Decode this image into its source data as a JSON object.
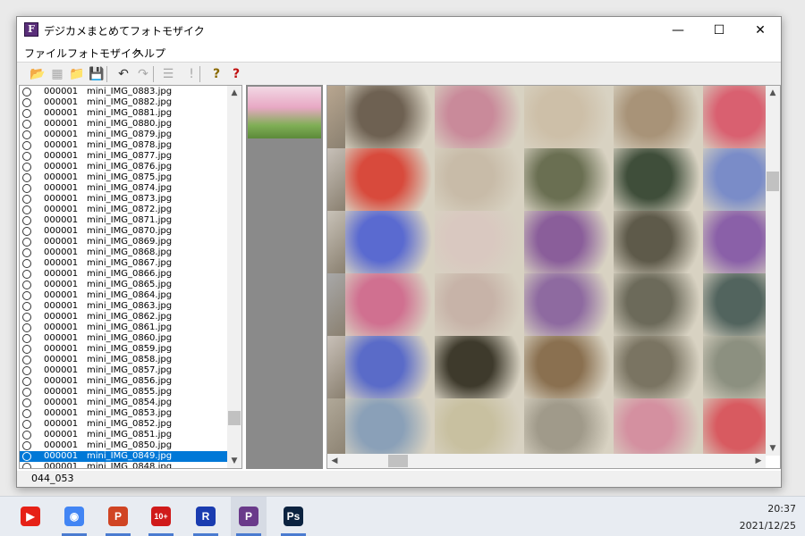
{
  "window": {
    "title": "デジカメまとめてフォトモザイク",
    "icon_letter": "F",
    "controls": {
      "minimize": "—",
      "maximize": "☐",
      "close": "✕"
    }
  },
  "menu": [
    "ファイル",
    "フォトモザイク",
    "ヘルプ"
  ],
  "toolbar": [
    {
      "name": "open-folder-icon",
      "glyph": "📂"
    },
    {
      "name": "new-image-icon",
      "glyph": "▦",
      "disabled": true
    },
    {
      "name": "folder-icon",
      "glyph": "📁"
    },
    {
      "name": "save-icon",
      "glyph": "💾"
    },
    {
      "name": "undo-icon",
      "glyph": "↶"
    },
    {
      "name": "redo-icon",
      "glyph": "↷",
      "disabled": true
    },
    {
      "name": "settings-list-icon",
      "glyph": "☰",
      "disabled": true
    },
    {
      "name": "exclamation-icon",
      "glyph": "!",
      "disabled": true
    },
    {
      "name": "help-icon",
      "glyph": "?"
    },
    {
      "name": "about-help-icon",
      "glyph": "?"
    }
  ],
  "file_list": {
    "selected_index": 34,
    "items": [
      {
        "count": "000001",
        "name": "mini_IMG_0883.jpg"
      },
      {
        "count": "000001",
        "name": "mini_IMG_0882.jpg"
      },
      {
        "count": "000001",
        "name": "mini_IMG_0881.jpg"
      },
      {
        "count": "000001",
        "name": "mini_IMG_0880.jpg"
      },
      {
        "count": "000001",
        "name": "mini_IMG_0879.jpg"
      },
      {
        "count": "000001",
        "name": "mini_IMG_0878.jpg"
      },
      {
        "count": "000001",
        "name": "mini_IMG_0877.jpg"
      },
      {
        "count": "000001",
        "name": "mini_IMG_0876.jpg"
      },
      {
        "count": "000001",
        "name": "mini_IMG_0875.jpg"
      },
      {
        "count": "000001",
        "name": "mini_IMG_0874.jpg"
      },
      {
        "count": "000001",
        "name": "mini_IMG_0873.jpg"
      },
      {
        "count": "000001",
        "name": "mini_IMG_0872.jpg"
      },
      {
        "count": "000001",
        "name": "mini_IMG_0871.jpg"
      },
      {
        "count": "000001",
        "name": "mini_IMG_0870.jpg"
      },
      {
        "count": "000001",
        "name": "mini_IMG_0869.jpg"
      },
      {
        "count": "000001",
        "name": "mini_IMG_0868.jpg"
      },
      {
        "count": "000001",
        "name": "mini_IMG_0867.jpg"
      },
      {
        "count": "000001",
        "name": "mini_IMG_0866.jpg"
      },
      {
        "count": "000001",
        "name": "mini_IMG_0865.jpg"
      },
      {
        "count": "000001",
        "name": "mini_IMG_0864.jpg"
      },
      {
        "count": "000001",
        "name": "mini_IMG_0863.jpg"
      },
      {
        "count": "000001",
        "name": "mini_IMG_0862.jpg"
      },
      {
        "count": "000001",
        "name": "mini_IMG_0861.jpg"
      },
      {
        "count": "000001",
        "name": "mini_IMG_0860.jpg"
      },
      {
        "count": "000001",
        "name": "mini_IMG_0859.jpg"
      },
      {
        "count": "000001",
        "name": "mini_IMG_0858.jpg"
      },
      {
        "count": "000001",
        "name": "mini_IMG_0857.jpg"
      },
      {
        "count": "000001",
        "name": "mini_IMG_0856.jpg"
      },
      {
        "count": "000001",
        "name": "mini_IMG_0855.jpg"
      },
      {
        "count": "000001",
        "name": "mini_IMG_0854.jpg"
      },
      {
        "count": "000001",
        "name": "mini_IMG_0853.jpg"
      },
      {
        "count": "000001",
        "name": "mini_IMG_0852.jpg"
      },
      {
        "count": "000001",
        "name": "mini_IMG_0851.jpg"
      },
      {
        "count": "000001",
        "name": "mini_IMG_0850.jpg"
      },
      {
        "count": "000001",
        "name": "mini_IMG_0849.jpg"
      },
      {
        "count": "000001",
        "name": "mini_IMG_0848.jpg"
      }
    ]
  },
  "scrollbars": {
    "up": "▲",
    "down": "▼",
    "left": "◀",
    "right": "▶"
  },
  "mosaic": {
    "tiles": [
      [
        "#6e6152",
        "#c98a9a",
        "#cdbfa8",
        "#a89378",
        "#d96070"
      ],
      [
        "#d84a3c",
        "#c8bba8",
        "#6a6f52",
        "#3f4e3a",
        "#7a8cc8"
      ],
      [
        "#5a6ad0",
        "#d9c8c0",
        "#8a5e9a",
        "#5e5a4a",
        "#8a60a8"
      ],
      [
        "#d07090",
        "#c7b3a8",
        "#8e6aa0",
        "#6c6a5a",
        "#52645e"
      ],
      [
        "#5a6bc8",
        "#3e3a2c",
        "#8a7050",
        "#7a7462",
        "#8c9080"
      ],
      [
        "#8aa0b8",
        "#c8c0a0",
        "#a09a8a",
        "#d490a0",
        "#d85a60"
      ]
    ],
    "left_strip": [
      "#b8a690",
      "#c7c0b8",
      "#c8c2b8",
      "#a8a8a8",
      "#c8c0b8",
      "#b0a898"
    ]
  },
  "status": {
    "text": "044_053"
  },
  "taskbar": {
    "apps": [
      {
        "name": "youtube-icon",
        "glyph": "▶",
        "color": "#e62117"
      },
      {
        "name": "chrome-icon",
        "glyph": "◉",
        "color": "#4285f4"
      },
      {
        "name": "powerpoint-icon",
        "glyph": "P",
        "color": "#d04423"
      },
      {
        "name": "ten-plus-icon",
        "glyph": "10+",
        "color": "#d01a1a"
      },
      {
        "name": "r-app-icon",
        "glyph": "R",
        "color": "#1a3cb0"
      },
      {
        "name": "photomosaic-app-icon",
        "glyph": "P",
        "color": "#6a3a8a",
        "active": true
      },
      {
        "name": "photoshop-icon",
        "glyph": "Ps",
        "color": "#0c2340"
      }
    ],
    "time": "20:37",
    "date": "2021/12/25"
  }
}
